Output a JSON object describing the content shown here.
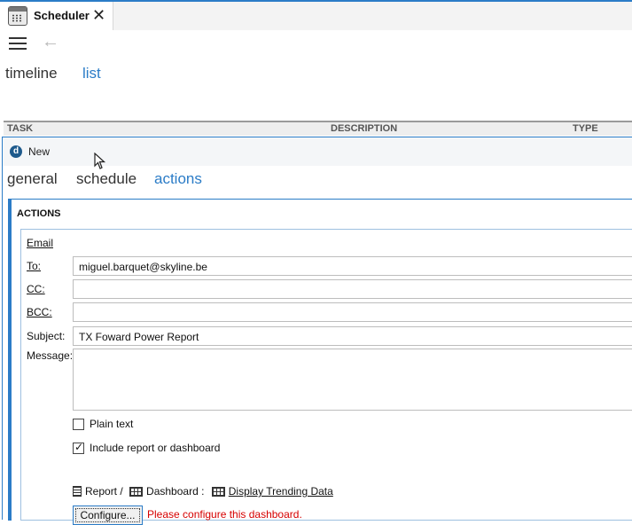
{
  "tab": {
    "title": "Scheduler",
    "icon": "calendar-icon"
  },
  "nav": {
    "views": [
      "timeline",
      "list"
    ],
    "active_view": "list"
  },
  "grid": {
    "columns": [
      "TASK",
      "DESCRIPTION",
      "TYPE"
    ]
  },
  "panel": {
    "title": "New",
    "tabs": [
      "general",
      "schedule",
      "actions"
    ],
    "active_tab": "actions",
    "section_title": "ACTIONS",
    "email": {
      "legend": "Email",
      "to_label": "To:",
      "to_value": "miguel.barquet@skyline.be",
      "cc_label": "CC:",
      "cc_value": "",
      "bcc_label": "BCC:",
      "bcc_value": "",
      "subject_label": "Subject:",
      "subject_value": "TX Foward Power Report",
      "message_label": "Message:",
      "message_value": "",
      "plain_text_label": "Plain text",
      "plain_text_checked": false,
      "include_label": "Include report or dashboard",
      "include_checked": true,
      "report_label": "Report /",
      "dashboard_label": "Dashboard :",
      "dashboard_name": "Display Trending Data",
      "configure_label": "Configure...",
      "warning": "Please configure this dashboard."
    }
  },
  "colors": {
    "accent": "#2b7cc7",
    "warning": "#d60000"
  }
}
